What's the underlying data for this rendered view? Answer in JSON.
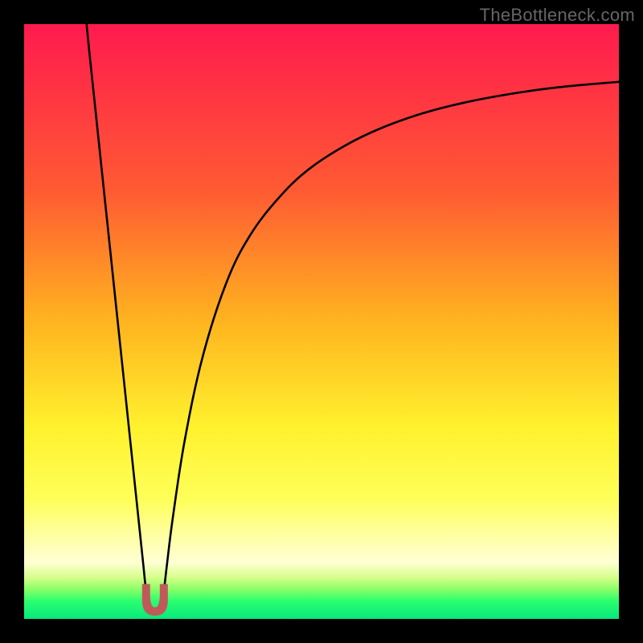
{
  "watermark": "TheBottleneck.com",
  "chart_data": {
    "type": "line",
    "title": "",
    "xlabel": "",
    "ylabel": "",
    "xlim": [
      0,
      100
    ],
    "ylim": [
      0,
      100
    ],
    "grid": false,
    "legend": false,
    "background_gradient_stops": [
      {
        "offset": 0.0,
        "color": "#ff1a4e"
      },
      {
        "offset": 0.28,
        "color": "#ff5a33"
      },
      {
        "offset": 0.5,
        "color": "#ffb41f"
      },
      {
        "offset": 0.68,
        "color": "#fff22e"
      },
      {
        "offset": 0.8,
        "color": "#ffff5a"
      },
      {
        "offset": 0.86,
        "color": "#ffffa3"
      },
      {
        "offset": 0.905,
        "color": "#ffffd4"
      },
      {
        "offset": 0.93,
        "color": "#d7ff8a"
      },
      {
        "offset": 0.95,
        "color": "#8bff67"
      },
      {
        "offset": 0.97,
        "color": "#2bff6f"
      },
      {
        "offset": 1.0,
        "color": "#08e87c"
      }
    ],
    "series": [
      {
        "name": "left-branch",
        "x": [
          10.5,
          11,
          12,
          13,
          14,
          15,
          16,
          17,
          18,
          19,
          20,
          20.5,
          21
        ],
        "y": [
          100,
          95,
          85.5,
          76,
          66.5,
          57,
          47.5,
          38,
          28.5,
          19,
          9.5,
          4.8,
          2.5
        ]
      },
      {
        "name": "right-branch",
        "x": [
          23,
          23.5,
          24,
          25,
          27,
          30,
          34,
          38,
          43,
          48,
          54,
          60,
          67,
          74,
          82,
          90,
          100
        ],
        "y": [
          2.5,
          4.8,
          9,
          17,
          30,
          44,
          56.5,
          64.5,
          71,
          75.7,
          79.6,
          82.5,
          85,
          86.8,
          88.3,
          89.4,
          90.3
        ]
      }
    ],
    "dip_marker": {
      "cx": 22,
      "cy": 3.2,
      "rx": 2.1,
      "ry": 2.6,
      "notch_depth": 1.6,
      "color": "#c05a5a",
      "stroke": "#c05a5a"
    }
  }
}
